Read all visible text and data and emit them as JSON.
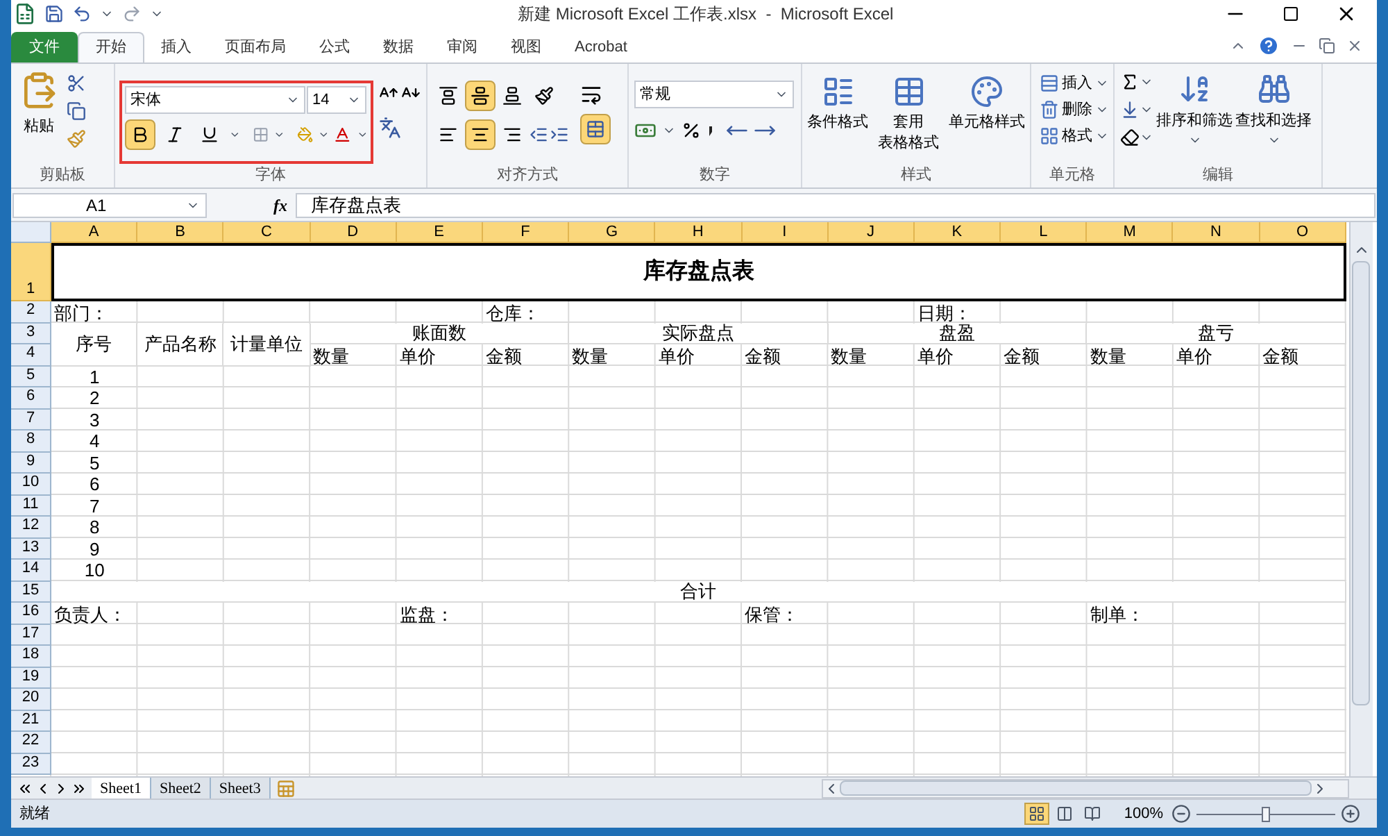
{
  "title_bar": {
    "title": "新建 Microsoft Excel 工作表.xlsx  -  Microsoft Excel"
  },
  "tabs": [
    {
      "label": "文件",
      "kind": "file",
      "selected": false
    },
    {
      "label": "开始",
      "kind": "tab",
      "selected": true
    },
    {
      "label": "插入",
      "kind": "tab",
      "selected": false
    },
    {
      "label": "页面布局",
      "kind": "tab",
      "selected": false
    },
    {
      "label": "公式",
      "kind": "tab",
      "selected": false
    },
    {
      "label": "数据",
      "kind": "tab",
      "selected": false
    },
    {
      "label": "审阅",
      "kind": "tab",
      "selected": false
    },
    {
      "label": "视图",
      "kind": "tab",
      "selected": false
    },
    {
      "label": "Acrobat",
      "kind": "tab",
      "selected": false
    }
  ],
  "clipboard": {
    "label": "剪贴板",
    "paste": "粘贴"
  },
  "font": {
    "label": "字体",
    "font_name": "宋体",
    "font_size": "14",
    "bold": true,
    "italic": false,
    "underline": false
  },
  "alignment": {
    "label": "对齐方式",
    "top": false,
    "middle": true,
    "bottom": false,
    "left": false,
    "center": true,
    "right": false,
    "merge": true
  },
  "number": {
    "label": "数字",
    "format": "常规"
  },
  "styles": {
    "label": "样式",
    "buttons": [
      {
        "lines": [
          "条件格式"
        ]
      },
      {
        "lines": [
          "套用",
          "表格格式"
        ]
      },
      {
        "lines": [
          "单元格样式"
        ]
      }
    ]
  },
  "cells": {
    "label": "单元格",
    "buttons": [
      "插入",
      "删除",
      "格式"
    ]
  },
  "editing": {
    "label": "编辑",
    "buttons": [
      "排序和筛选",
      "查找和选择"
    ]
  },
  "formula_bar": {
    "name_box": "A1",
    "function_label": "fx",
    "formula": "库存盘点表"
  },
  "sheet": {
    "columns": [
      {
        "label": "A",
        "selected": true
      },
      {
        "label": "B",
        "selected": true
      },
      {
        "label": "C",
        "selected": true
      },
      {
        "label": "D",
        "selected": true
      },
      {
        "label": "E",
        "selected": true
      },
      {
        "label": "F",
        "selected": true
      },
      {
        "label": "G",
        "selected": true
      },
      {
        "label": "H",
        "selected": true
      },
      {
        "label": "I",
        "selected": true
      },
      {
        "label": "J",
        "selected": true
      },
      {
        "label": "K",
        "selected": true
      },
      {
        "label": "L",
        "selected": true
      },
      {
        "label": "M",
        "selected": true
      },
      {
        "label": "N",
        "selected": true
      },
      {
        "label": "O",
        "selected": true
      }
    ],
    "rows": [
      {
        "header": "1",
        "selected": true,
        "cells": [
          "库存盘点表"
        ]
      },
      {
        "header": "2",
        "selected": false,
        "cells": [
          "部门：",
          "",
          "",
          "",
          "",
          "仓库：",
          "",
          "",
          "",
          "",
          "日期："
        ]
      },
      {
        "header": "3",
        "selected": false,
        "cells": [
          "序号",
          "产品名称",
          "计量单位",
          "账面数",
          "实际盘点",
          "盘盈",
          "盘亏"
        ]
      },
      {
        "header": "4",
        "selected": false,
        "cells": [
          "数量",
          "单价",
          "金额",
          "数量",
          "单价",
          "金额",
          "数量",
          "单价",
          "金额",
          "数量",
          "单价",
          "金额"
        ]
      },
      {
        "header": "5",
        "selected": false,
        "cells": [
          "1"
        ]
      },
      {
        "header": "6",
        "selected": false,
        "cells": [
          "2"
        ]
      },
      {
        "header": "7",
        "selected": false,
        "cells": [
          "3"
        ]
      },
      {
        "header": "8",
        "selected": false,
        "cells": [
          "4"
        ]
      },
      {
        "header": "9",
        "selected": false,
        "cells": [
          "5"
        ]
      },
      {
        "header": "10",
        "selected": false,
        "cells": [
          "6"
        ]
      },
      {
        "header": "11",
        "selected": false,
        "cells": [
          "7"
        ]
      },
      {
        "header": "12",
        "selected": false,
        "cells": [
          "8"
        ]
      },
      {
        "header": "13",
        "selected": false,
        "cells": [
          "9"
        ]
      },
      {
        "header": "14",
        "selected": false,
        "cells": [
          "10"
        ]
      },
      {
        "header": "15",
        "selected": false,
        "cells": [
          "合计"
        ]
      },
      {
        "header": "16",
        "selected": false,
        "cells": [
          "负责人：",
          "",
          "",
          "",
          "监盘：",
          "",
          "",
          "",
          "保管：",
          "",
          "",
          "",
          "制单："
        ]
      },
      {
        "header": "17",
        "selected": false
      },
      {
        "header": "18",
        "selected": false
      },
      {
        "header": "19",
        "selected": false
      },
      {
        "header": "20",
        "selected": false
      },
      {
        "header": "21",
        "selected": false
      },
      {
        "header": "22",
        "selected": false
      },
      {
        "header": "23",
        "selected": false
      }
    ]
  },
  "sheet_tabs": [
    {
      "label": "Sheet1",
      "selected": true
    },
    {
      "label": "Sheet2",
      "selected": false
    },
    {
      "label": "Sheet3",
      "selected": false
    }
  ],
  "status_bar": {
    "status": "就绪",
    "views": [
      {
        "kind": "normal",
        "selected": true
      },
      {
        "kind": "page_layout",
        "selected": false
      },
      {
        "kind": "page_break",
        "selected": false
      }
    ],
    "zoom": "100%",
    "level": 0.5
  }
}
